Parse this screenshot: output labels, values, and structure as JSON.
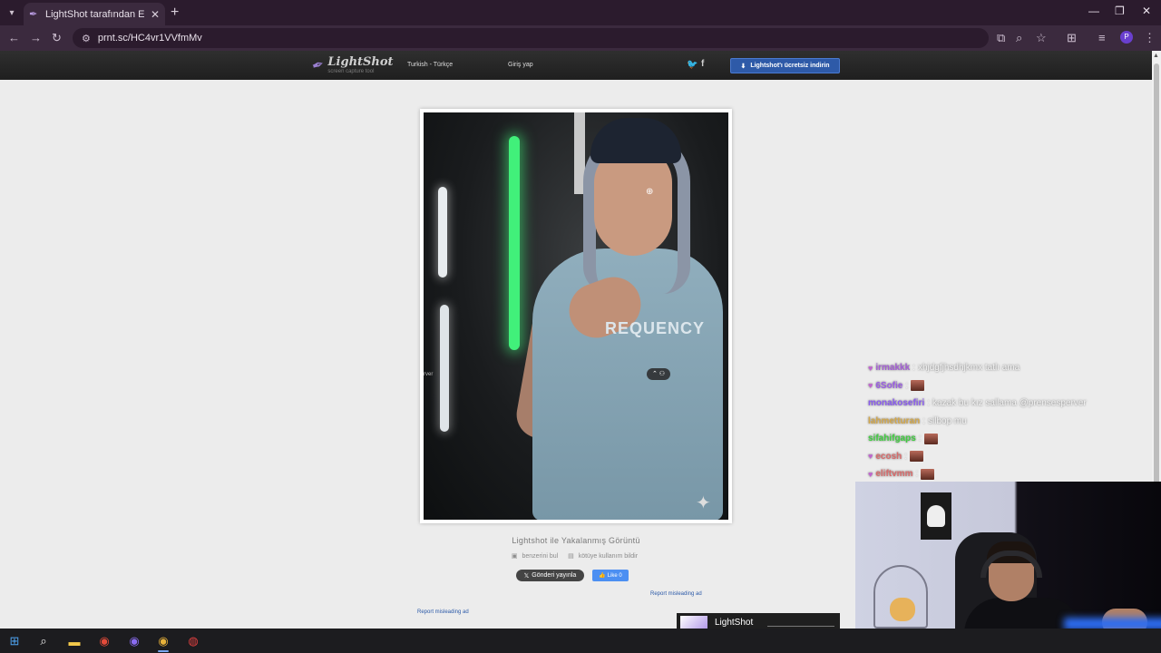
{
  "browser": {
    "tab_title": "LightShot tarafından Ekran Görü",
    "url": "prnt.sc/HC4vr1VVfmMv",
    "profile_initial": "P"
  },
  "lightshot": {
    "logo_name": "LightShot",
    "logo_tagline": "screen capture tool",
    "language": "Turkish - Türkçe",
    "login": "Giriş yap",
    "download_button": "Lightshot'ı ücretsiz indirin",
    "caption_title": "Lightshot ile Yakalanmış Görüntü",
    "find_similar": "benzerini bul",
    "report_abuse": "kötüye kullanım bildir",
    "tweet_button": "Gönderi yayınla",
    "like_button": "Like 0",
    "report_ad_1": "Report misleading ad",
    "report_ad_2": "Report misleading ad",
    "ad_name": "LightShot"
  },
  "screenshot": {
    "shirt_print": "REQUENCY",
    "peek_text": "rver"
  },
  "chat": [
    {
      "user": "irmakkk",
      "msg": "xhjdgfjhsdhjkmx tatlı ama",
      "color": "#a55fd6",
      "badge": true,
      "emote": false
    },
    {
      "user": "6Sofie",
      "msg": "",
      "color": "#9b5de5",
      "badge": true,
      "emote": true
    },
    {
      "user": "monakosefiri",
      "msg": "kazak bu kız sallama @prensesperver",
      "color": "#8a5cf0",
      "badge": false,
      "emote": false
    },
    {
      "user": "lahmetturan",
      "msg": "silbop mu",
      "color": "#d4a84a",
      "badge": false,
      "emote": false
    },
    {
      "user": "sifahifgaps",
      "msg": "",
      "color": "#3fcf3f",
      "badge": false,
      "emote": true
    },
    {
      "user": "ecosh",
      "msg": "",
      "color": "#d96b6b",
      "badge": true,
      "emote": true
    },
    {
      "user": "eliftvmm",
      "msg": "",
      "color": "#d96b6b",
      "badge": true,
      "emote": true
    }
  ]
}
